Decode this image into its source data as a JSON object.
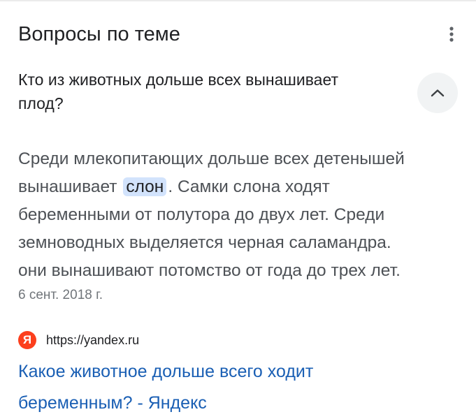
{
  "header": {
    "title": "Вопросы по теме",
    "more_icon": "more-vert-icon"
  },
  "question": {
    "text_line1": "Кто из животных дольше всех вынашивает",
    "text_line2": "плод?",
    "toggle_icon": "chevron-up-icon"
  },
  "answer": {
    "line1": "Среди млекопитающих дольше всех детенышей",
    "line2_before": "вынашивает",
    "line2_highlight": "слон",
    "line2_after": ". Самки слона ходят",
    "line3": "беременными от полутора до двух лет. Среди",
    "line4": "земноводных выделяется черная саламандра.",
    "line5": "они вынашивают потомство от года до трех лет.",
    "date": "6 сент. 2018 г."
  },
  "source": {
    "favicon_letter": "Я",
    "favicon_color": "#fc3f1d",
    "url": "https://yandex.ru"
  },
  "result": {
    "title_line1": "Какое животное дольше всего ходит",
    "title_line2": "беременным? - Яндекс",
    "link_color": "#1a5fb4"
  }
}
